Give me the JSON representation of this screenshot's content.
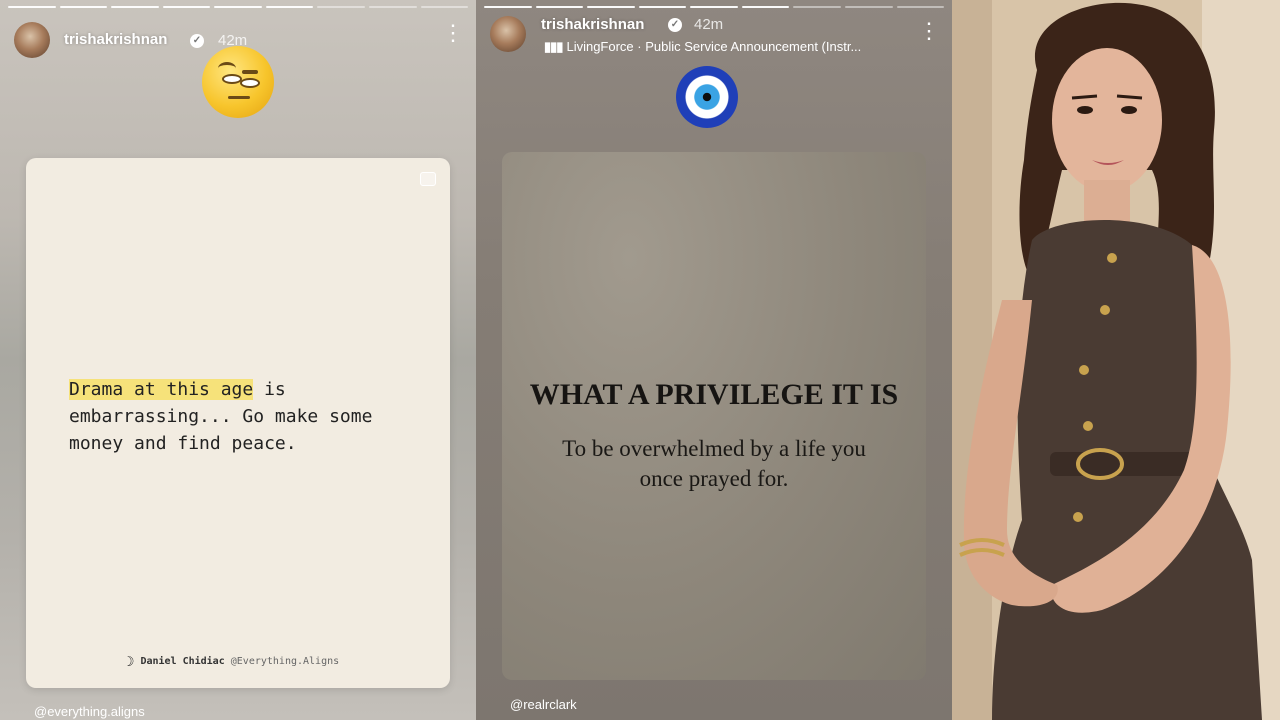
{
  "story1": {
    "username": "trishakrishnan",
    "time": "42m",
    "quote_highlight": "Drama at this age",
    "quote_rest": " is embarrassing... Go make some money and find peace.",
    "credit_author": "Daniel Chidiac",
    "credit_handle": "@Everything.Aligns",
    "tag": "@everything.aligns",
    "progress_done": 6,
    "progress_total": 9,
    "sticker_icon": "raised-eyebrow-face-emoji"
  },
  "story2": {
    "username": "trishakrishnan",
    "time": "42m",
    "music": "LivingForce · Public Service Announcement (Instr...",
    "card_title": "WHAT A PRIVILEGE IT IS",
    "card_subtitle": "To be overwhelmed by a life you once prayed for.",
    "tag": "@realrclark",
    "progress_done": 6,
    "progress_total": 9,
    "sticker_icon": "nazar-eye-emoji"
  },
  "colors": {
    "highlight": "#f6e27a",
    "verified": "#ffffff"
  }
}
